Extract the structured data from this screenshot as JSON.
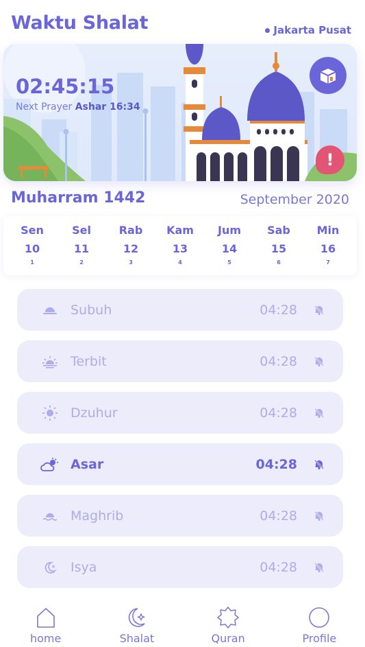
{
  "header": {
    "title": "Waktu Shalat",
    "location": "Jakarta Pusat"
  },
  "banner": {
    "time": "02:45:15",
    "next_label": "Next Prayer",
    "next_value": "Ashar 16:34",
    "kaaba_icon": "kaaba-icon",
    "alert_icon": "alert-icon",
    "alert_glyph": "!"
  },
  "calendar": {
    "hijri_month": "Muharram 1442",
    "gregorian_month": "September 2020",
    "days": [
      {
        "name": "Sen",
        "date": "10",
        "hijri": "1"
      },
      {
        "name": "Sel",
        "date": "11",
        "hijri": "2"
      },
      {
        "name": "Rab",
        "date": "12",
        "hijri": "3"
      },
      {
        "name": "Kam",
        "date": "13",
        "hijri": "4"
      },
      {
        "name": "Jum",
        "date": "14",
        "hijri": "5"
      },
      {
        "name": "Sab",
        "date": "15",
        "hijri": "6"
      },
      {
        "name": "Min",
        "date": "16",
        "hijri": "7"
      }
    ]
  },
  "prayers": [
    {
      "name": "Subuh",
      "time": "04:28",
      "icon": "sun-horizon-icon"
    },
    {
      "name": "Terbit",
      "time": "04:28",
      "icon": "sunrise-icon"
    },
    {
      "name": "Dzuhur",
      "time": "04:28",
      "icon": "sun-icon"
    },
    {
      "name": "Asar",
      "time": "04:28",
      "icon": "cloud-sun-icon",
      "active": true
    },
    {
      "name": "Maghrib",
      "time": "04:28",
      "icon": "sunset-icon"
    },
    {
      "name": "Isya",
      "time": "04:28",
      "icon": "moon-star-icon"
    }
  ],
  "nav": [
    {
      "label": "home",
      "icon": "home-icon"
    },
    {
      "label": "Shalat",
      "icon": "crescent-star-icon"
    },
    {
      "label": "Quran",
      "icon": "octagram-icon"
    },
    {
      "label": "Profile",
      "icon": "profile-circle-icon"
    }
  ],
  "colors": {
    "primary": "#6a65d8",
    "row_background": "#ececfa",
    "row_text_inactive": "#aeacea",
    "alert": "#e25574"
  }
}
